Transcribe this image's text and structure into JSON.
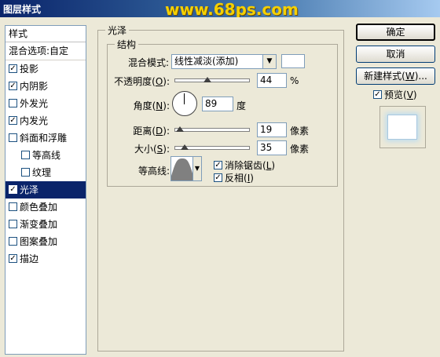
{
  "window": {
    "title": "图层样式",
    "watermark": "www.68ps.com"
  },
  "styles": {
    "header": "样式",
    "blend_options": "混合选项:自定",
    "items": [
      {
        "label": "投影",
        "checked": true
      },
      {
        "label": "内阴影",
        "checked": true
      },
      {
        "label": "外发光",
        "checked": false
      },
      {
        "label": "内发光",
        "checked": true
      },
      {
        "label": "斜面和浮雕",
        "checked": false
      },
      {
        "label": "等高线",
        "checked": false
      },
      {
        "label": "纹理",
        "checked": false
      },
      {
        "label": "光泽",
        "checked": true,
        "selected": true
      },
      {
        "label": "颜色叠加",
        "checked": false
      },
      {
        "label": "渐变叠加",
        "checked": false
      },
      {
        "label": "图案叠加",
        "checked": false
      },
      {
        "label": "描边",
        "checked": true
      }
    ]
  },
  "satin": {
    "group_title": "光泽",
    "structure_title": "结构",
    "blend_mode": {
      "label_pre": "混合模式",
      "label_key": "",
      "value": "线性减淡(添加)"
    },
    "opacity": {
      "label_pre": "不透明度(",
      "label_key": "O",
      "label_post": "):",
      "value": "44",
      "unit": "%",
      "fraction": 0.44
    },
    "angle": {
      "label_pre": "角度(",
      "label_key": "N",
      "label_post": "):",
      "value": "89",
      "unit": "度"
    },
    "distance": {
      "label_pre": "距离(",
      "label_key": "D",
      "label_post": "):",
      "value": "19",
      "unit": "像素",
      "fraction": 0.076
    },
    "size": {
      "label_pre": "大小(",
      "label_key": "S",
      "label_post": "):",
      "value": "35",
      "unit": "像素",
      "fraction": 0.14
    },
    "contour": {
      "label": "等高线:"
    },
    "anti_alias": {
      "label_pre": "消除锯齿(",
      "label_key": "L",
      "label_post": ")",
      "checked": true
    },
    "invert": {
      "label_pre": "反相(",
      "label_key": "I",
      "label_post": ")",
      "checked": true
    }
  },
  "buttons": {
    "ok": "确定",
    "cancel": "取消",
    "new_style_pre": "新建样式(",
    "new_style_key": "W",
    "new_style_post": ")...",
    "preview_pre": "预览(",
    "preview_key": "V",
    "preview_post": ")",
    "preview_checked": true
  }
}
